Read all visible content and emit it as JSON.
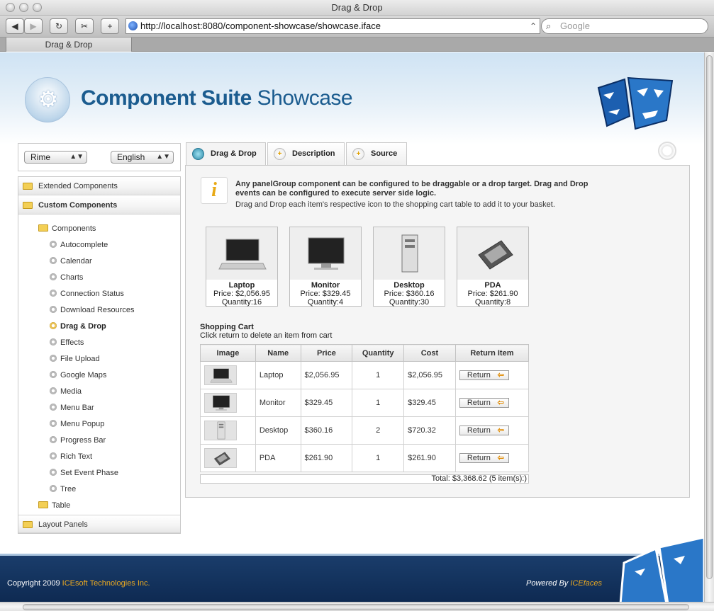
{
  "window": {
    "title": "Drag & Drop"
  },
  "browser": {
    "url": "http://localhost:8080/component-showcase/showcase.iface",
    "search_placeholder": "Google",
    "tab_label": "Drag & Drop"
  },
  "header": {
    "brand_bold": "Component Suite",
    "brand_light": "Showcase"
  },
  "selectors": {
    "theme": "Rime",
    "language": "English"
  },
  "nav": {
    "extended": "Extended Components",
    "custom": "Custom Components",
    "components_folder": "Components",
    "items": [
      "Autocomplete",
      "Calendar",
      "Charts",
      "Connection Status",
      "Download Resources",
      "Drag & Drop",
      "Effects",
      "File Upload",
      "Google Maps",
      "Media",
      "Menu Bar",
      "Menu Popup",
      "Progress Bar",
      "Rich Text",
      "Set Event Phase",
      "Tree"
    ],
    "active_item": "Drag & Drop",
    "table_folder": "Table",
    "layout": "Layout Panels"
  },
  "tabs": [
    {
      "label": "Drag & Drop",
      "active": true
    },
    {
      "label": "Description",
      "active": false
    },
    {
      "label": "Source",
      "active": false
    }
  ],
  "intro": {
    "bold": "Any panelGroup component can be configured to be draggable or a drop target. Drag and Drop events can be configured to execute server side logic.",
    "sub": "Drag and Drop each item's respective icon to the shopping cart table to add it to your basket."
  },
  "products": [
    {
      "name": "Laptop",
      "price": "Price: $2,056.95",
      "qty": "Quantity:16"
    },
    {
      "name": "Monitor",
      "price": "Price: $329.45",
      "qty": "Quantity:4"
    },
    {
      "name": "Desktop",
      "price": "Price: $360.16",
      "qty": "Quantity:30"
    },
    {
      "name": "PDA",
      "price": "Price: $261.90",
      "qty": "Quantity:8"
    }
  ],
  "cart": {
    "title": "Shopping Cart",
    "subtitle": "Click return to delete an item from cart",
    "columns": [
      "Image",
      "Name",
      "Price",
      "Quantity",
      "Cost",
      "Return Item"
    ],
    "rows": [
      {
        "name": "Laptop",
        "price": "$2,056.95",
        "qty": "1",
        "cost": "$2,056.95",
        "action": "Return"
      },
      {
        "name": "Monitor",
        "price": "$329.45",
        "qty": "1",
        "cost": "$329.45",
        "action": "Return"
      },
      {
        "name": "Desktop",
        "price": "$360.16",
        "qty": "2",
        "cost": "$720.32",
        "action": "Return"
      },
      {
        "name": "PDA",
        "price": "$261.90",
        "qty": "1",
        "cost": "$261.90",
        "action": "Return"
      }
    ],
    "total": "Total: $3,368.62 (5 item(s):)"
  },
  "footer": {
    "copyright": "Copyright 2009 ",
    "company": "ICEsoft Technologies Inc.",
    "powered": "Powered By ",
    "product": "ICEfaces"
  }
}
